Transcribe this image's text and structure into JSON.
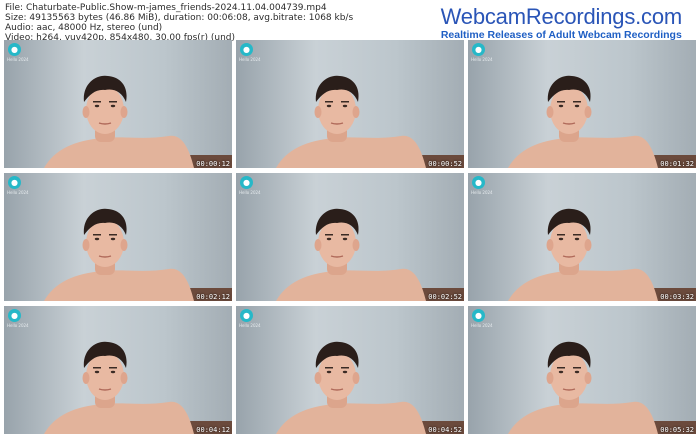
{
  "meta": {
    "file_line": "File: Chaturbate-Public.Show-m-james_friends-2024.11.04.004739.mp4",
    "size_line": "Size: 49135563 bytes (46.86 MiB), duration: 00:06:08, avg.bitrate: 1068 kb/s",
    "audio_line": "Audio: aac, 48000 Hz, stereo (und)",
    "video_line": "Video: h264, yuv420p, 854x480, 30.00 fps(r) (und)"
  },
  "brand": {
    "title": "WebcamRecordings.com",
    "subtitle": "Realtime Releases of Adult Webcam Recordings"
  },
  "thumbnails": [
    {
      "cam_text": "Hello 2024",
      "timestamp": "00:00:12"
    },
    {
      "cam_text": "Hello 2024",
      "timestamp": "00:00:52"
    },
    {
      "cam_text": "Hello 2024",
      "timestamp": "00:01:32"
    },
    {
      "cam_text": "Hello 2024",
      "timestamp": "00:02:12"
    },
    {
      "cam_text": "Hello 2024",
      "timestamp": "00:02:52"
    },
    {
      "cam_text": "Hello 2024",
      "timestamp": "00:03:32"
    },
    {
      "cam_text": "Hello 2024",
      "timestamp": "00:04:12"
    },
    {
      "cam_text": "Hello 2024",
      "timestamp": "00:04:52"
    },
    {
      "cam_text": "Hello 2024",
      "timestamp": "00:05:32"
    }
  ],
  "colors": {
    "brand_blue": "#2a55b7",
    "cam_logo": "#26b8c8"
  }
}
